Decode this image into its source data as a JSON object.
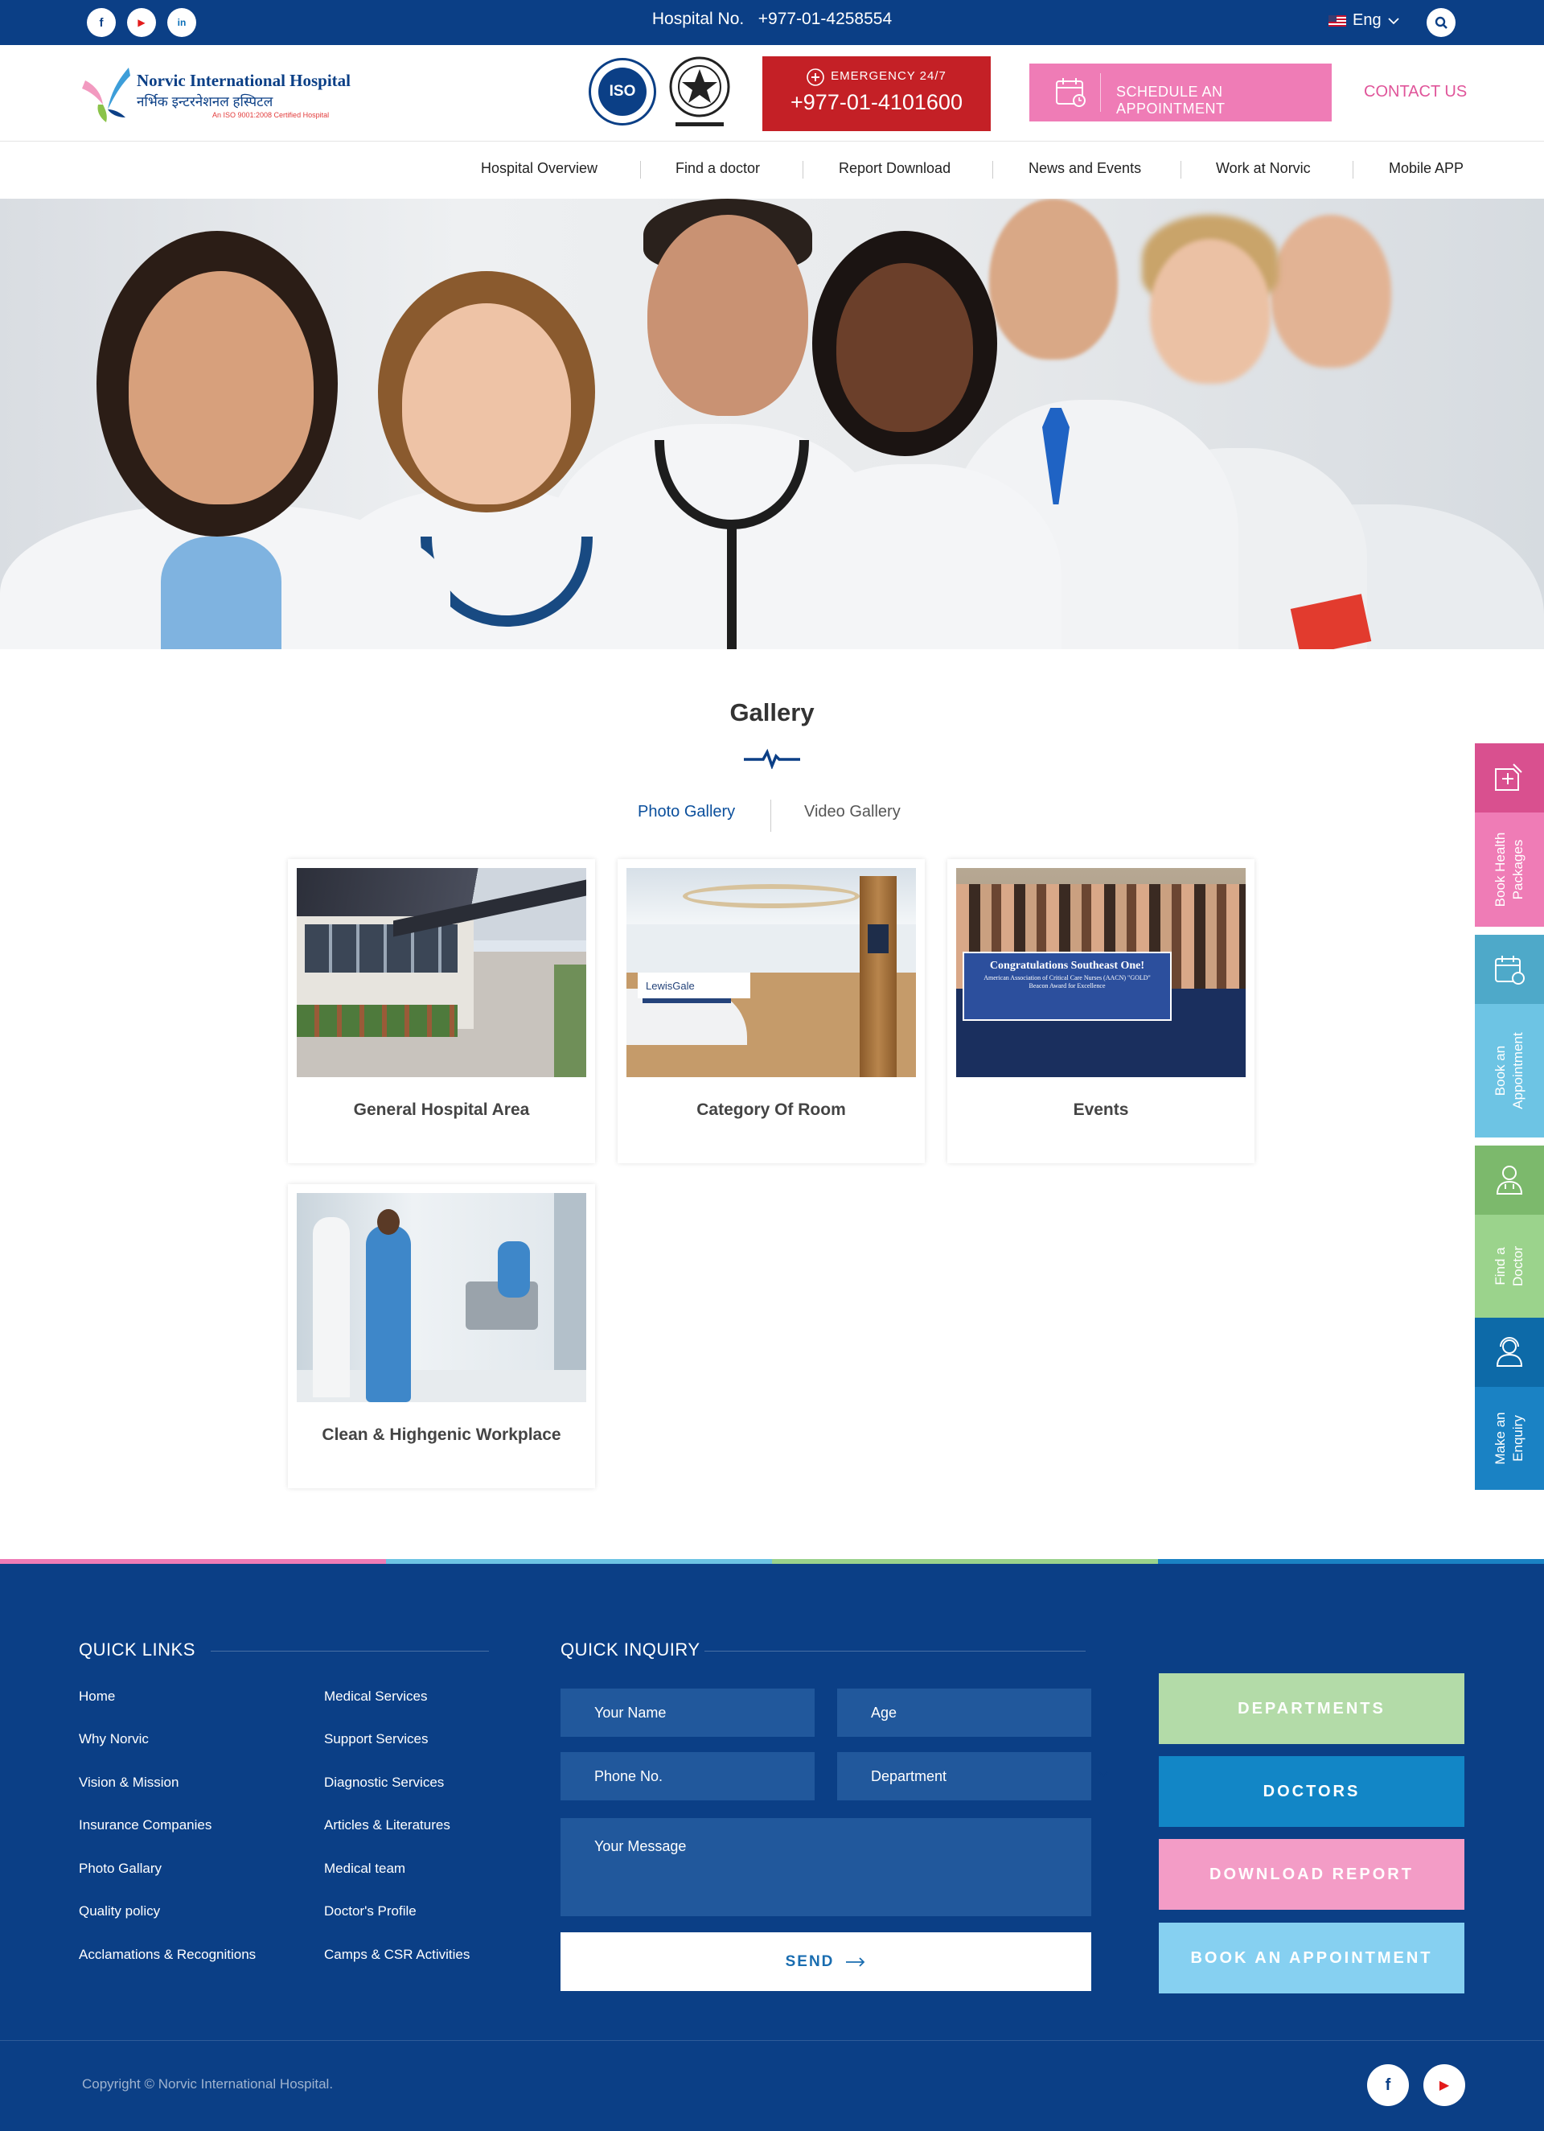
{
  "topbar": {
    "social": [
      {
        "name": "facebook-icon",
        "glyph": "f",
        "color": "#0b3f86"
      },
      {
        "name": "youtube-icon",
        "glyph": "▶",
        "color": "#e31b1b"
      },
      {
        "name": "linkedin-icon",
        "glyph": "in",
        "color": "#0b6fb8"
      }
    ],
    "hospital_no_label": "Hospital No.",
    "hospital_no": "+977-01-4258554",
    "language": "Eng"
  },
  "header": {
    "logo_name_en": "Norvic International Hospital",
    "logo_name_np": "नर्भिक इन्टरनेशनल हस्पिटल",
    "logo_tagline": "An ISO 9001:2008 Certified Hospital",
    "iso_label": "ISO",
    "emergency_label": "EMERGENCY 24/7",
    "emergency_number": "+977-01-4101600",
    "schedule_label": "SCHEDULE AN APPOINTMENT",
    "contact_label": "CONTACT US"
  },
  "nav": [
    "Hospital Overview",
    "Find a doctor",
    "Report Download",
    "News and Events",
    "Work at Norvic",
    "Mobile APP"
  ],
  "gallery": {
    "title": "Gallery",
    "tabs": [
      {
        "label": "Photo Gallery",
        "active": true
      },
      {
        "label": "Video Gallery",
        "active": false
      }
    ],
    "items": [
      {
        "caption": "General Hospital Area"
      },
      {
        "caption": "Category Of Room"
      },
      {
        "caption": "Events",
        "banner_title": "Congratulations Southeast One!",
        "banner_sub": "American Association of Critical Care Nurses (AACN) \"GOLD\" Beacon Award for Excellence"
      },
      {
        "caption": "Clean & Highgenic Workplace"
      }
    ]
  },
  "side_tabs": [
    {
      "label_line1": "Book Health",
      "label_line2": "Packages",
      "icon": "health-package-icon",
      "top_color": "#d9508f",
      "bottom_color": "#ef7cb6"
    },
    {
      "label_line1": "Book an",
      "label_line2": "Appointment",
      "icon": "calendar-icon",
      "top_color": "#4ea9c9",
      "bottom_color": "#6dc4e4"
    },
    {
      "label_line1": "Find a",
      "label_line2": "Doctor",
      "icon": "doctor-icon",
      "top_color": "#7cb96c",
      "bottom_color": "#9bd38c"
    },
    {
      "label_line1": "Make an",
      "label_line2": "Enquiry",
      "icon": "support-agent-icon",
      "top_color": "#0d6aa8",
      "bottom_color": "#1a82c4"
    }
  ],
  "footer": {
    "quick_links_title": "QUICK LINKS",
    "quick_links_col1": [
      "Home",
      "Why Norvic",
      "Vision & Mission",
      "Insurance Companies",
      "Photo Gallary",
      "Quality policy",
      "Acclamations & Recognitions"
    ],
    "quick_links_col2": [
      "Medical Services",
      "Support Services",
      "Diagnostic Services",
      "Articles & Literatures",
      "Medical team",
      "Doctor's Profile",
      "Camps & CSR Activities"
    ],
    "inquiry_title": "QUICK INQUIRY",
    "inquiry_fields": {
      "name": "Your Name",
      "age": "Age",
      "phone": "Phone No.",
      "department": "Department",
      "message": "Your Message"
    },
    "send_label": "SEND",
    "buttons": [
      {
        "label": "DEPARTMENTS",
        "color": "#b3dba8"
      },
      {
        "label": "DOCTORS",
        "color": "#1286c6"
      },
      {
        "label": "DOWNLOAD REPORT",
        "color": "#f39cc6"
      },
      {
        "label": "BOOK AN APPOINTMENT",
        "color": "#86d0f1"
      }
    ],
    "copyright": "Copyright © Norvic International Hospital."
  },
  "colors": {
    "brand_blue": "#0b3f86",
    "emergency_red": "#c42026",
    "pink": "#ef7cb6"
  }
}
